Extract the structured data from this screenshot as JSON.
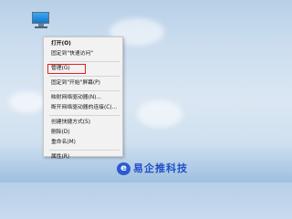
{
  "desktop": {
    "icon": "this-pc-icon"
  },
  "context_menu": {
    "items": [
      {
        "label": "打开(O)",
        "bold": true
      },
      {
        "label": "固定到\"快速访问\""
      },
      {
        "separator": true
      },
      {
        "label": "管理(G)",
        "highlighted": true
      },
      {
        "separator": true
      },
      {
        "label": "固定到\"开始\"屏幕(P)"
      },
      {
        "separator": true
      },
      {
        "label": "映射网络驱动器(N)..."
      },
      {
        "label": "断开网络驱动器的连接(C)..."
      },
      {
        "separator": true
      },
      {
        "label": "创建快捷方式(S)"
      },
      {
        "label": "删除(D)"
      },
      {
        "label": "重命名(M)"
      },
      {
        "separator": true
      },
      {
        "label": "属性(R)"
      }
    ]
  },
  "watermark": {
    "text": "易企推科技",
    "logo_icon": "yiqitui-logo-icon"
  },
  "colors": {
    "highlight_border": "#e02020",
    "watermark_blue": "#1f4fc7",
    "menu_background": "#f2f2f2"
  }
}
